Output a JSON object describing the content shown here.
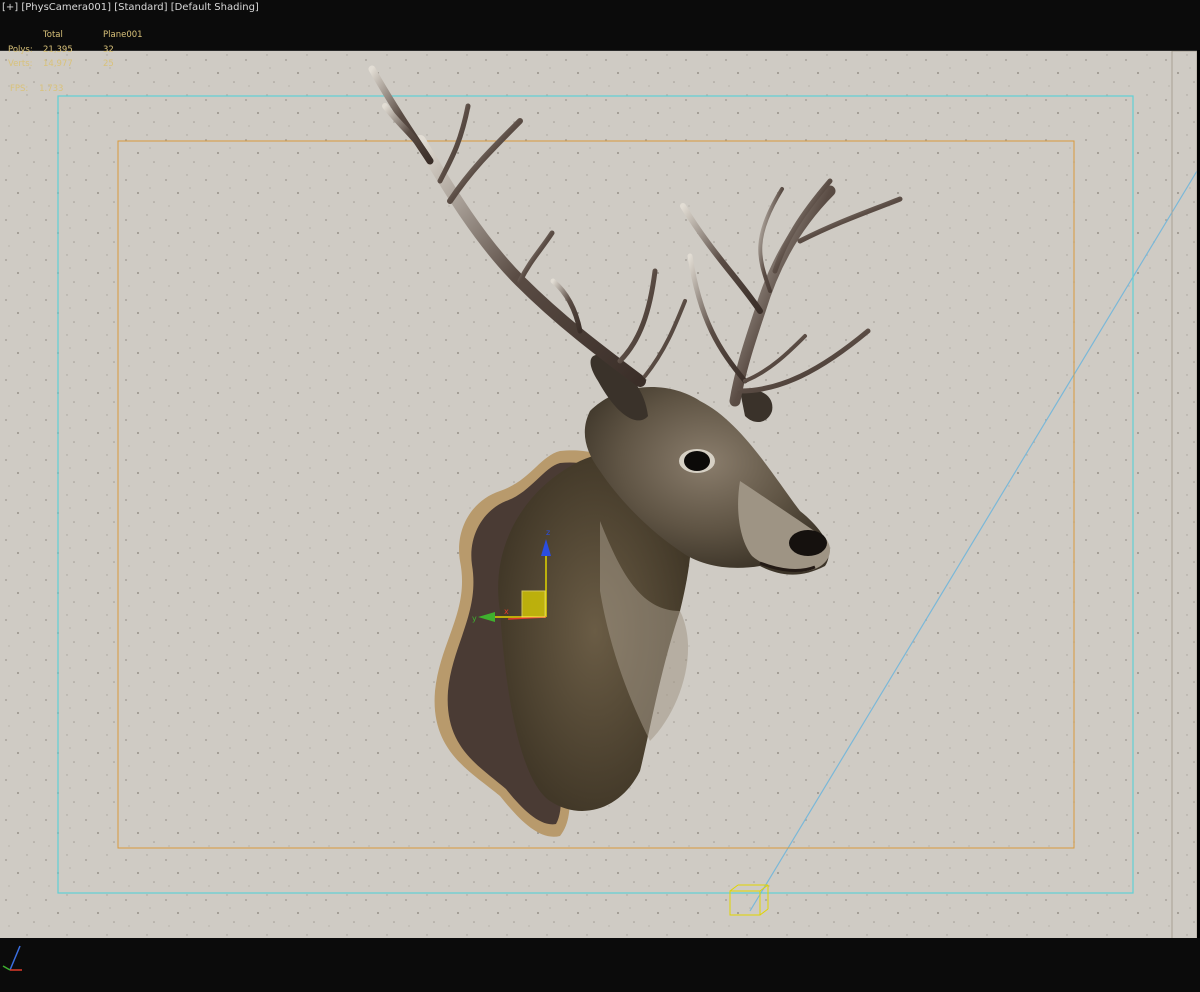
{
  "viewport": {
    "label_plus": "[+]",
    "label_camera": "[PhysCamera001]",
    "label_mode": "[Standard]",
    "label_shading": "[Default Shading]"
  },
  "stats": {
    "col_total_header": "Total",
    "col_object_header": "Plane001",
    "polys_label": "Polys:",
    "polys_total": "21,395",
    "polys_object": "32",
    "verts_label": "Verts:",
    "verts_total": "14,977",
    "verts_object": "25",
    "fps_label": "FPS:",
    "fps_value": "1.733"
  },
  "gizmo": {
    "axis_x": "x",
    "axis_y": "y",
    "axis_z": "z"
  },
  "colors": {
    "safe_frame_outer": "#5fd0d6",
    "safe_frame_inner": "#d89a3c",
    "wall": "#cfcbc4",
    "plaque_wood": "#4a3b34",
    "plaque_rim": "#b89a6c",
    "gizmo_x": "#e03a2a",
    "gizmo_y": "#3fb02e",
    "gizmo_z": "#2a4de0",
    "selection_box": "#e0d400"
  }
}
